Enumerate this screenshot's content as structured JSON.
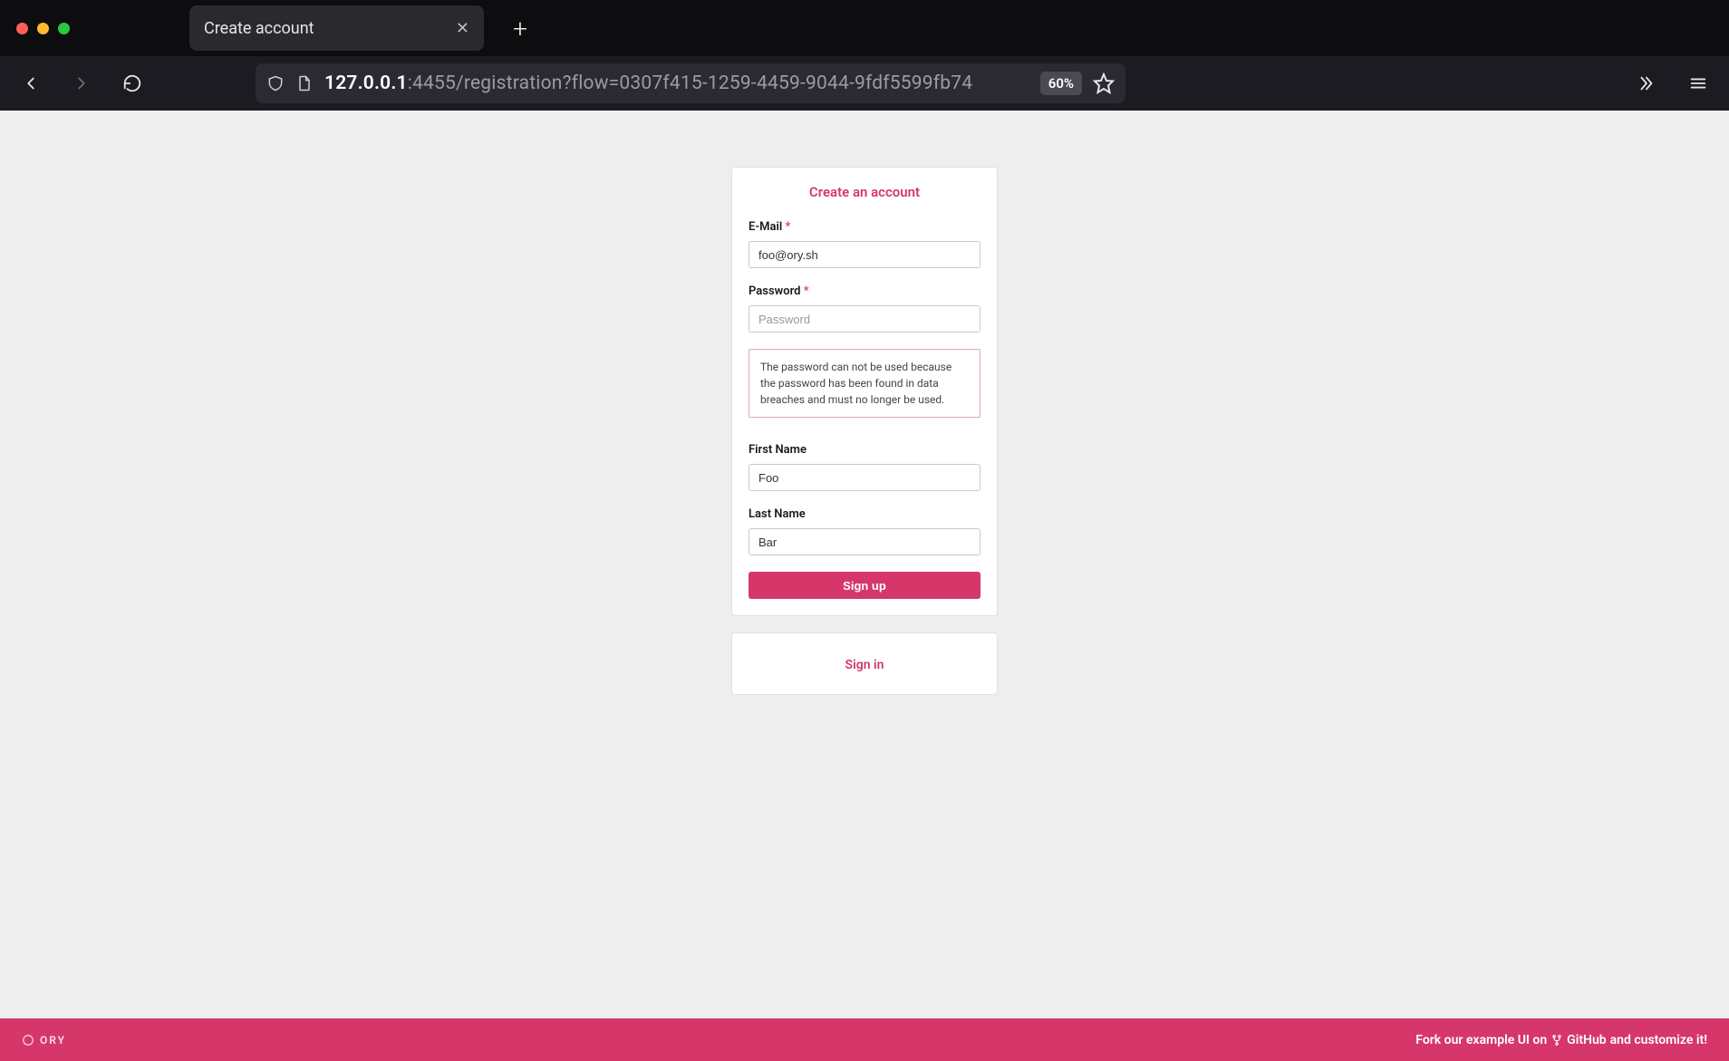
{
  "browser": {
    "tab_title": "Create account",
    "url_host": "127.0.0.1",
    "url_path": ":4455/registration?flow=0307f415-1259-4459-9044-9fdf5599fb74",
    "zoom": "60%"
  },
  "form": {
    "title": "Create an account",
    "email": {
      "label": "E-Mail",
      "required_mark": "*",
      "value": "foo@ory.sh"
    },
    "password": {
      "label": "Password",
      "required_mark": "*",
      "placeholder": "Password",
      "error": "The password can not be used because the password has been found in data breaches and must no longer be used."
    },
    "first_name": {
      "label": "First Name",
      "value": "Foo"
    },
    "last_name": {
      "label": "Last Name",
      "value": "Bar"
    },
    "submit_label": "Sign up"
  },
  "signin": {
    "label": "Sign in"
  },
  "footer": {
    "brand": "ORY",
    "fork_prefix": "Fork our example UI on",
    "fork_link": "GitHub",
    "fork_suffix": "and customize it!"
  }
}
